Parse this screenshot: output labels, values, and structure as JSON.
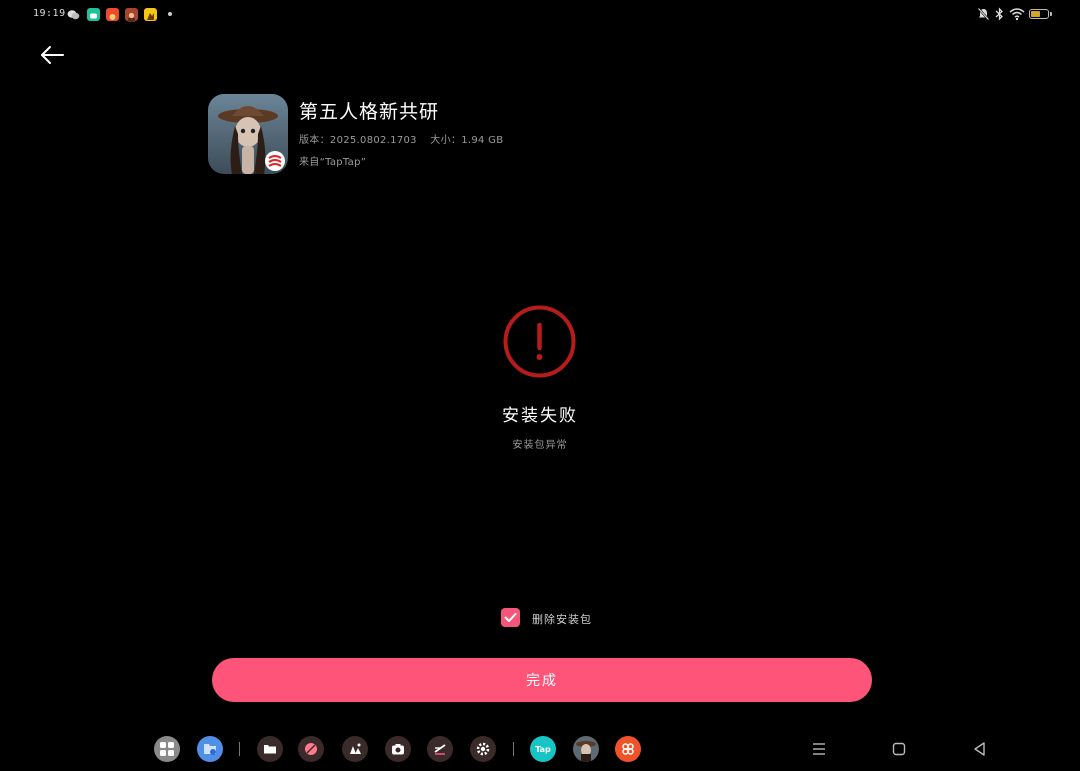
{
  "status_bar": {
    "time": "19:19",
    "notification_icons": [
      "wechat-icon",
      "message-icon",
      "game-app-icon",
      "game-app-icon-2",
      "game-app-icon-3"
    ],
    "right_icons": [
      "mute-bell-icon",
      "bluetooth-icon",
      "wifi-icon",
      "battery-icon"
    ],
    "battery_level_percent": 55,
    "battery_color": "#d4a72c"
  },
  "app": {
    "name": "第五人格新共研",
    "version_label": "版本：",
    "version": "2025.0802.1703",
    "size_label": "大小：",
    "size": "1.94 GB",
    "source": "来自“TapTap”"
  },
  "result": {
    "title": "安装失败",
    "subtitle": "安装包异常",
    "color": "#b71c1c"
  },
  "delete_package": {
    "label": "删除安装包",
    "checked": true
  },
  "done_button": {
    "label": "完成",
    "color": "#ff5479"
  },
  "dock": {
    "apps": [
      "app-drawer-icon",
      "files-icon",
      "file-manager-icon",
      "browser-icon",
      "gallery-icon",
      "camera-icon",
      "notes-icon",
      "settings-icon",
      "taptap-icon",
      "game-avatar-icon",
      "app-store-icon"
    ],
    "taptap_label": "Tap"
  },
  "nav": [
    "menu-icon",
    "home-icon",
    "back-icon"
  ]
}
